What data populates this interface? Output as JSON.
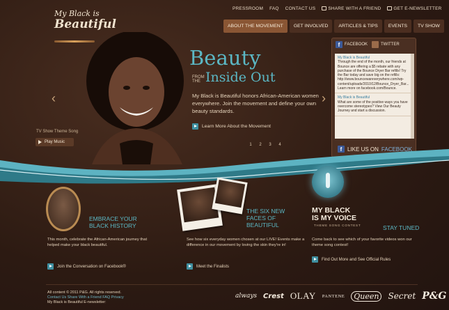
{
  "header": {
    "util_links": [
      "PRESSROOM",
      "FAQ",
      "CONTACT US",
      "SHARE WITH A FRIEND",
      "GET E-NEWSLETTER"
    ],
    "logo": {
      "line1": "My Black is",
      "line2": "Beautiful"
    },
    "nav": [
      {
        "label": "ABOUT THE MOVEMENT",
        "active": true
      },
      {
        "label": "GET INVOLVED",
        "active": false
      },
      {
        "label": "ARTICLES & TIPS",
        "active": false
      },
      {
        "label": "EVENTS",
        "active": false
      },
      {
        "label": "TV SHOW",
        "active": false
      }
    ]
  },
  "hero": {
    "title": "Beauty",
    "from_the": "FROM THE",
    "subtitle": "Inside Out",
    "body": "My Black is Beautiful honors African-American women everywhere. Join the movement and define your own beauty standards.",
    "link": "Learn More About the Movement",
    "pages": [
      "1",
      "2",
      "3",
      "4"
    ],
    "tv_theme": "TV Show Theme Song",
    "play_label": "Play Music"
  },
  "social": {
    "tab_facebook": "FACEBOOK",
    "tab_twitter": "TWITTER",
    "posts": [
      {
        "title": "My Black is Beautiful",
        "text": "Through the end of the month, our friends at Bounce are offering a $5 rebate with any purchase of the Bounce Dryer Bar refills! Try the Bar today and save big on the refills: http://www.bouncewareverywhere.com/wp-content/uploads/2010/12/Bounce_Dryer_Bar... Learn more on facebook.com/Bounce."
      },
      {
        "title": "My Black is Beautiful",
        "text": "What are some of the positive ways you have overcome stereotypes? View Our Beauty Journey and start a discussion."
      }
    ],
    "like_prefix": "LIKE US ON",
    "like_brand": "FACEBOOK"
  },
  "features": [
    {
      "title": "EMBRACE YOUR BLACK HISTORY",
      "text": "This month, celebrate the African-American journey that helped make your black beautiful.",
      "link": "Join the Conversation on Facebook®"
    },
    {
      "title": "THE SIX NEW FACES OF BEAUTIFUL",
      "text": "See how six everyday women chosen at our LIVE! Events make a difference in our movement by loving the skin they're in!",
      "link": "Meet the Finalists"
    },
    {
      "title": "STAY TUNED",
      "logo_line1": "MY BLACK",
      "logo_line2": "IS MY VOICE",
      "logo_sub": "THEME SONG CONTEST",
      "text": "Come back to see which of your favorite videos won our theme song contest!",
      "link": "Find Out More and See Official Rules"
    }
  ],
  "footer": {
    "copyright": "All content © 2011 P&G. All rights reserved.",
    "links": [
      "Contact Us",
      "Share With a Friend",
      "FAQ",
      "Privacy"
    ],
    "newsletter": "My Black is Beautiful E-newsletter:",
    "brands": [
      "always",
      "Crest",
      "OLAY",
      "PANTENE",
      "Queen",
      "Secret",
      "P&G"
    ]
  }
}
